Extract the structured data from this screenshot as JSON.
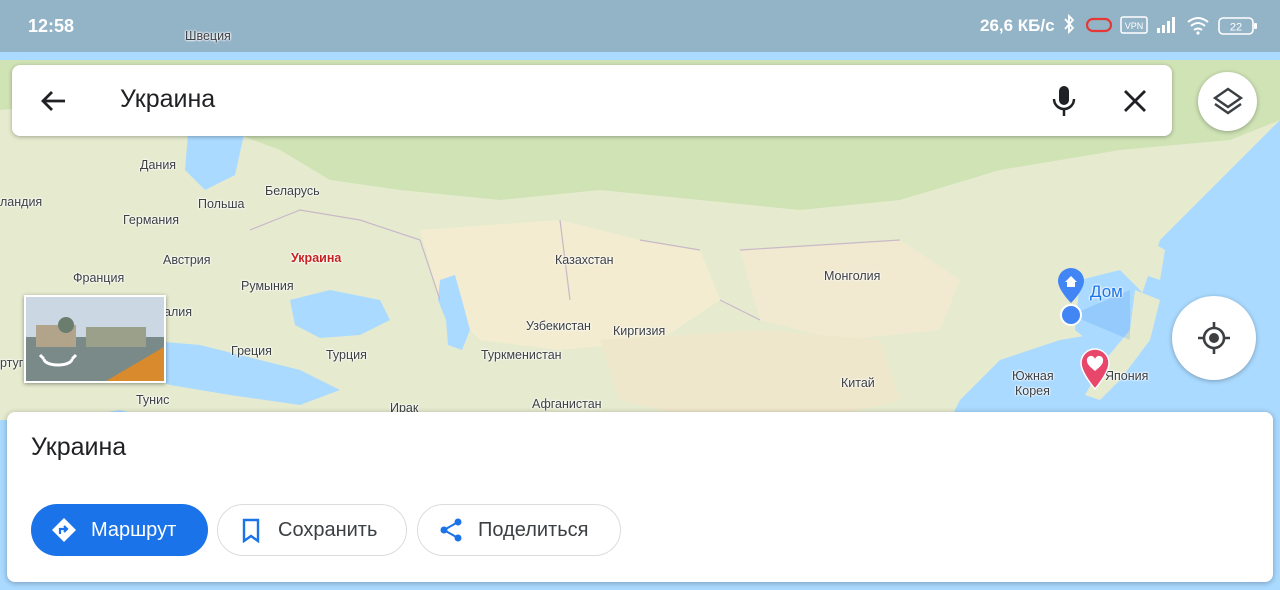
{
  "status_bar": {
    "time": "12:58",
    "speed": "26,6 КБ/с",
    "vpn_label": "VPN",
    "battery": "22"
  },
  "search": {
    "query": "Украина"
  },
  "map": {
    "labels": {
      "sweden": "Швеция",
      "denmark": "Дания",
      "netherlands_partial": "ландия",
      "belarus": "Беларусь",
      "poland": "Польша",
      "germany": "Германия",
      "ukraine": "Украина",
      "austria": "Австрия",
      "france": "Франция",
      "romania": "Румыния",
      "italy_partial": "алия",
      "greece": "Греция",
      "portugal_partial": "ртуг",
      "turkey": "Турция",
      "tunisia": "Тунис",
      "iraq": "Ирак",
      "kazakhstan": "Казахстан",
      "uzbekistan": "Узбекистан",
      "kyrgyzstan": "Киргизия",
      "turkmenistan": "Туркменистан",
      "afghanistan": "Афганистан",
      "mongolia": "Монголия",
      "china": "Китай",
      "south_korea_line1": "Южная",
      "south_korea_line2": "Корея",
      "japan": "Япония",
      "home": "Дом"
    }
  },
  "place_sheet": {
    "title": "Украина",
    "route_label": "Маршрут",
    "save_label": "Сохранить",
    "share_label": "Поделиться"
  },
  "icons": {
    "back": "arrow-left-icon",
    "mic": "mic-icon",
    "clear": "close-icon",
    "layers": "layers-icon",
    "locate": "my-location-icon",
    "route": "directions-icon",
    "save": "bookmark-icon",
    "share": "share-icon"
  },
  "colors": {
    "accent": "#1a73e8",
    "water": "#aadaff",
    "land": "#e8ecd8",
    "favorite_pin": "#e8476b"
  }
}
